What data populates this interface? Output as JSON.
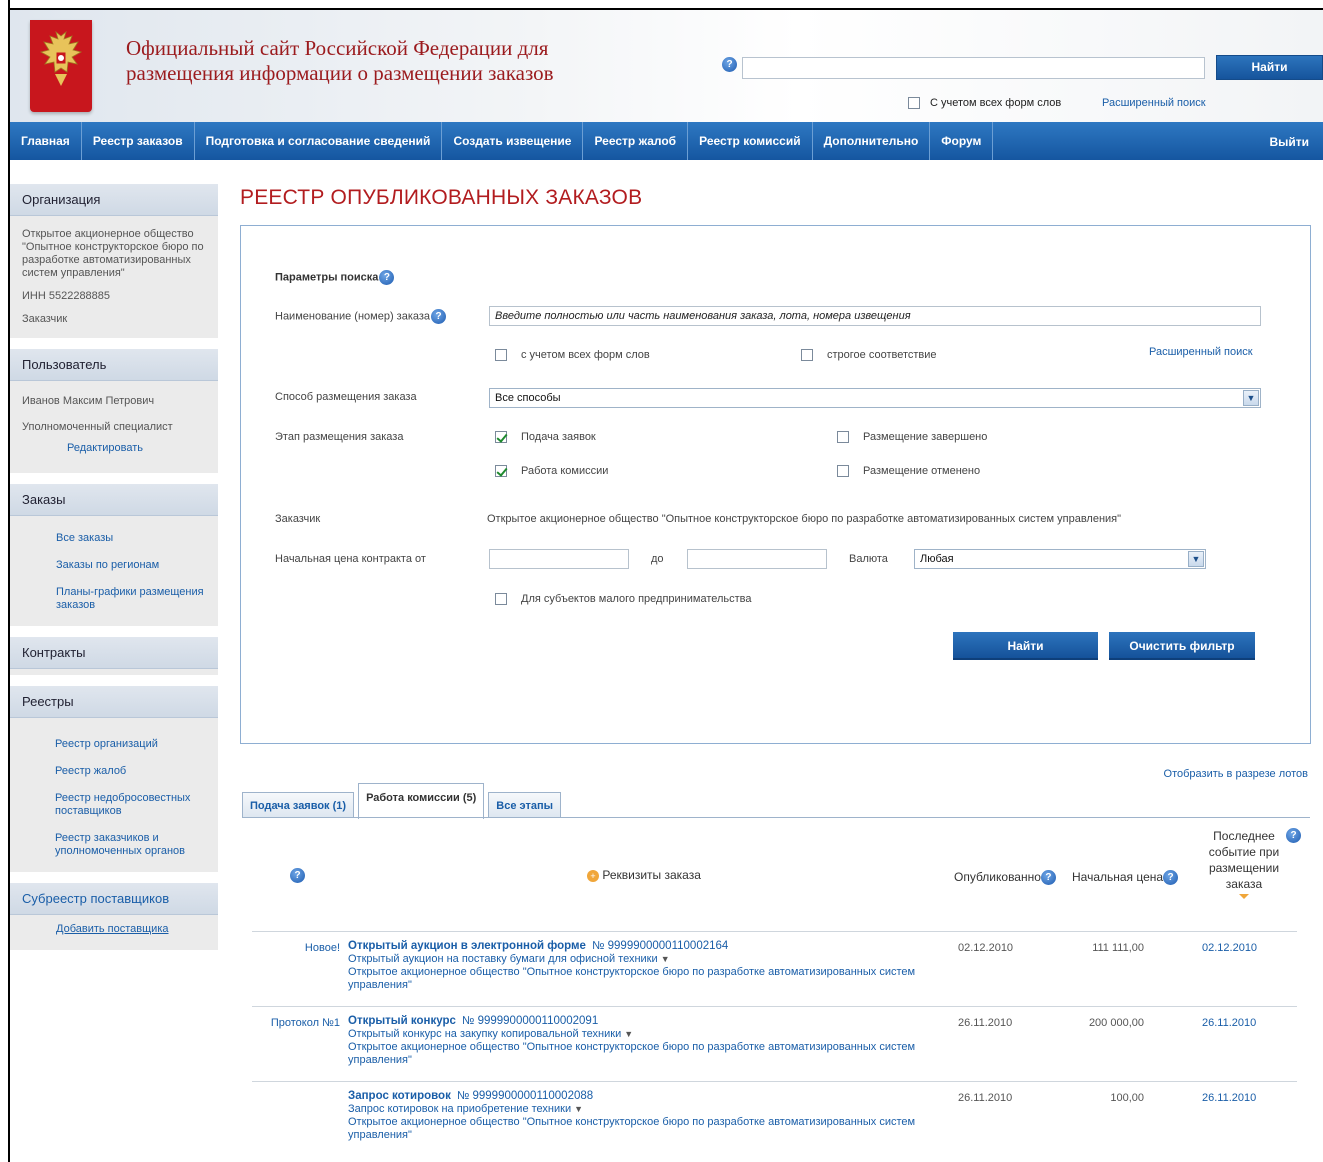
{
  "header": {
    "title_line1": "Официальный сайт Российской Федерации для",
    "title_line2": "размещения информации о размещении заказов",
    "search_placeholder": "",
    "find_label": "Найти",
    "all_forms_label": "С учетом всех форм слов",
    "advanced_label": "Расширенный поиск"
  },
  "nav": {
    "items": [
      "Главная",
      "Реестр заказов",
      "Подготовка и согласование сведений",
      "Создать извещение",
      "Реестр жалоб",
      "Реестр комиссий",
      "Дополнительно",
      "Форум"
    ],
    "exit_label": "Выйти"
  },
  "sidebar": {
    "org_head": "Организация",
    "org_name": "Открытое акционерное общество \"Опытное конструкторское бюро по разработке автоматизированных систем управления\"",
    "inn": "ИНН 5522288885",
    "role": "Заказчик",
    "user_head": "Пользователь",
    "user_name": "Иванов Максим Петрович",
    "user_role": "Уполномоченный специалист",
    "edit": "Редактировать",
    "orders_head": "Заказы",
    "orders_links": [
      "Все заказы",
      "Заказы по регионам",
      "Планы-графики размещения заказов"
    ],
    "contracts_head": "Контракты",
    "registers_head": "Реестры",
    "registers_links": [
      "Реестр организаций",
      "Реестр жалоб",
      "Реестр недобросовестных поставщиков",
      "Реестр заказчиков и уполномоченных органов"
    ],
    "suppliers_head": "Субреестр поставщиков",
    "add_supplier": "Добавить поставщика"
  },
  "main": {
    "title": "РЕЕСТР ОПУБЛИКОВАННЫХ ЗАКАЗОВ",
    "params_label": "Параметры поиска",
    "name_label": "Наименование (номер) заказа",
    "name_value": "Введите полностью или часть наименования заказа, лота, номера извещения",
    "all_forms": "с учетом всех форм слов",
    "strict": "строгое соответствие",
    "advanced": "Расширенный поиск",
    "method_label": "Способ размещения заказа",
    "method_value": "Все способы",
    "stage_label": "Этап размещения заказа",
    "stage_submit": "Подача заявок",
    "stage_commission": "Работа комиссии",
    "stage_completed": "Размещение завершено",
    "stage_cancelled": "Размещение отменено",
    "customer_label": "Заказчик",
    "customer_value": "Открытое акционерное общество \"Опытное конструкторское бюро по разработке автоматизированных систем управления\"",
    "price_from_label": "Начальная цена контракта от",
    "price_to_label": "до",
    "currency_label": "Валюта",
    "currency_value": "Любая",
    "small_business": "Для субъектов малого предпринимательства",
    "find_btn": "Найти",
    "clear_btn": "Очистить фильтр"
  },
  "results": {
    "lot_view": "Отобразить в разрезе лотов",
    "tabs": [
      "Подача заявок (1)",
      "Работа комиссии (5)",
      "Все этапы"
    ],
    "active_tab": 1,
    "col_details": "Реквизиты заказа",
    "col_published": "Опубликованно",
    "col_price": "Начальная цена",
    "col_last": "Последнее событие при размещении заказа",
    "rows": [
      {
        "status": "Новое!",
        "type": "Открытый аукцион в электронной форме",
        "number": "№  9999900000110002164",
        "subject": "Открытый аукцион на поставку бумаги для офисной техники",
        "org": "Открытое акционерное общество \"Опытное конструкторское бюро по разработке автоматизированных систем управления\"",
        "published": "02.12.2010",
        "price": "111 111,00",
        "last": "02.12.2010"
      },
      {
        "status": "Протокол №1",
        "type": "Открытый конкурс",
        "number": "№  9999900000110002091",
        "subject": "Открытый конкурс на закупку копировальной техники",
        "org": "Открытое акционерное общество \"Опытное конструкторское бюро по разработке автоматизированных систем управления\"",
        "published": "26.11.2010",
        "price": "200 000,00",
        "last": "26.11.2010"
      },
      {
        "status": "",
        "type": "Запрос котировок",
        "number": "№  9999900000110002088",
        "subject": "Запрос котировок на приобретение техники",
        "org": "Открытое акционерное общество \"Опытное конструкторское бюро по разработке автоматизированных систем управления\"",
        "published": "26.11.2010",
        "price": "100,00",
        "last": "26.11.2010"
      }
    ]
  }
}
